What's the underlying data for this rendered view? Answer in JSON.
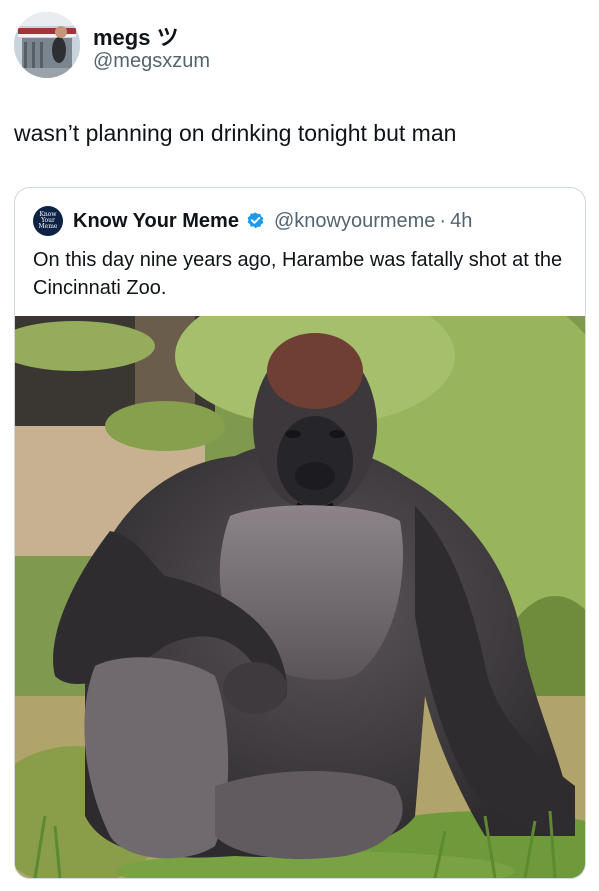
{
  "tweet": {
    "author": {
      "display_name": "megs ツ",
      "handle": "@megsxzum"
    },
    "text": "wasn’t planning on drinking tonight but man"
  },
  "quoted_tweet": {
    "author": {
      "logo_text": [
        "Know",
        "Your",
        "Meme"
      ],
      "display_name": "Know Your Meme",
      "verified": true,
      "handle": "@knowyourmeme",
      "separator": "·",
      "time": "4h"
    },
    "text": "On this day nine years ago, Harambe was fatally shot at the Cincinnati Zoo.",
    "media": "photo of a silverback gorilla sitting on grass"
  },
  "colors": {
    "text_primary": "#0f1419",
    "text_secondary": "#536471",
    "verified_badge": "#1d9bf0",
    "card_border": "#cfd9de"
  }
}
